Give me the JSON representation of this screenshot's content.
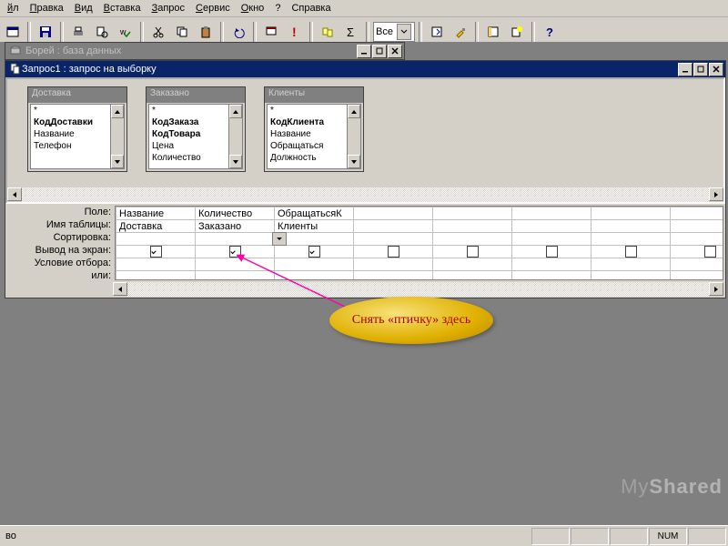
{
  "menu": [
    "йл",
    "Правка",
    "Вид",
    "Вставка",
    "Запрос",
    "Сервис",
    "Окно",
    "?",
    "Справка"
  ],
  "menu_ul": [
    0,
    0,
    0,
    0,
    0,
    0,
    0,
    null,
    null
  ],
  "toolbar_combo": "Все",
  "db_window_title": "Борей : база данных",
  "query_window_title": "Запрос1 : запрос на выборку",
  "tables": [
    {
      "title": "Доставка",
      "fields": [
        "*",
        "КодДоставки",
        "Название",
        "Телефон"
      ],
      "bold": [
        false,
        true,
        false,
        false
      ]
    },
    {
      "title": "Заказано",
      "fields": [
        "*",
        "КодЗаказа",
        "КодТовара",
        "Цена",
        "Количество"
      ],
      "bold": [
        false,
        true,
        true,
        false,
        false
      ]
    },
    {
      "title": "Клиенты",
      "fields": [
        "*",
        "КодКлиента",
        "Название",
        "Обращаться",
        "Должность"
      ],
      "bold": [
        false,
        true,
        false,
        false,
        false
      ]
    }
  ],
  "grid_rows": [
    "Поле:",
    "Имя таблицы:",
    "Сортировка:",
    "Вывод на экран:",
    "Условие отбора:",
    "или:"
  ],
  "grid_field_row": [
    "Название",
    "Количество",
    "ОбращатьсяК",
    "",
    "",
    "",
    "",
    ""
  ],
  "grid_table_row": [
    "Доставка",
    "Заказано",
    "Клиенты",
    "",
    "",
    "",
    "",
    ""
  ],
  "grid_checks": [
    true,
    true,
    true,
    false,
    false,
    false,
    false,
    false
  ],
  "callout_text": "Снять «птичку» здесь",
  "status_left": "во",
  "status_num": "NUM",
  "watermark": {
    "a": "My",
    "b": "Shared"
  }
}
